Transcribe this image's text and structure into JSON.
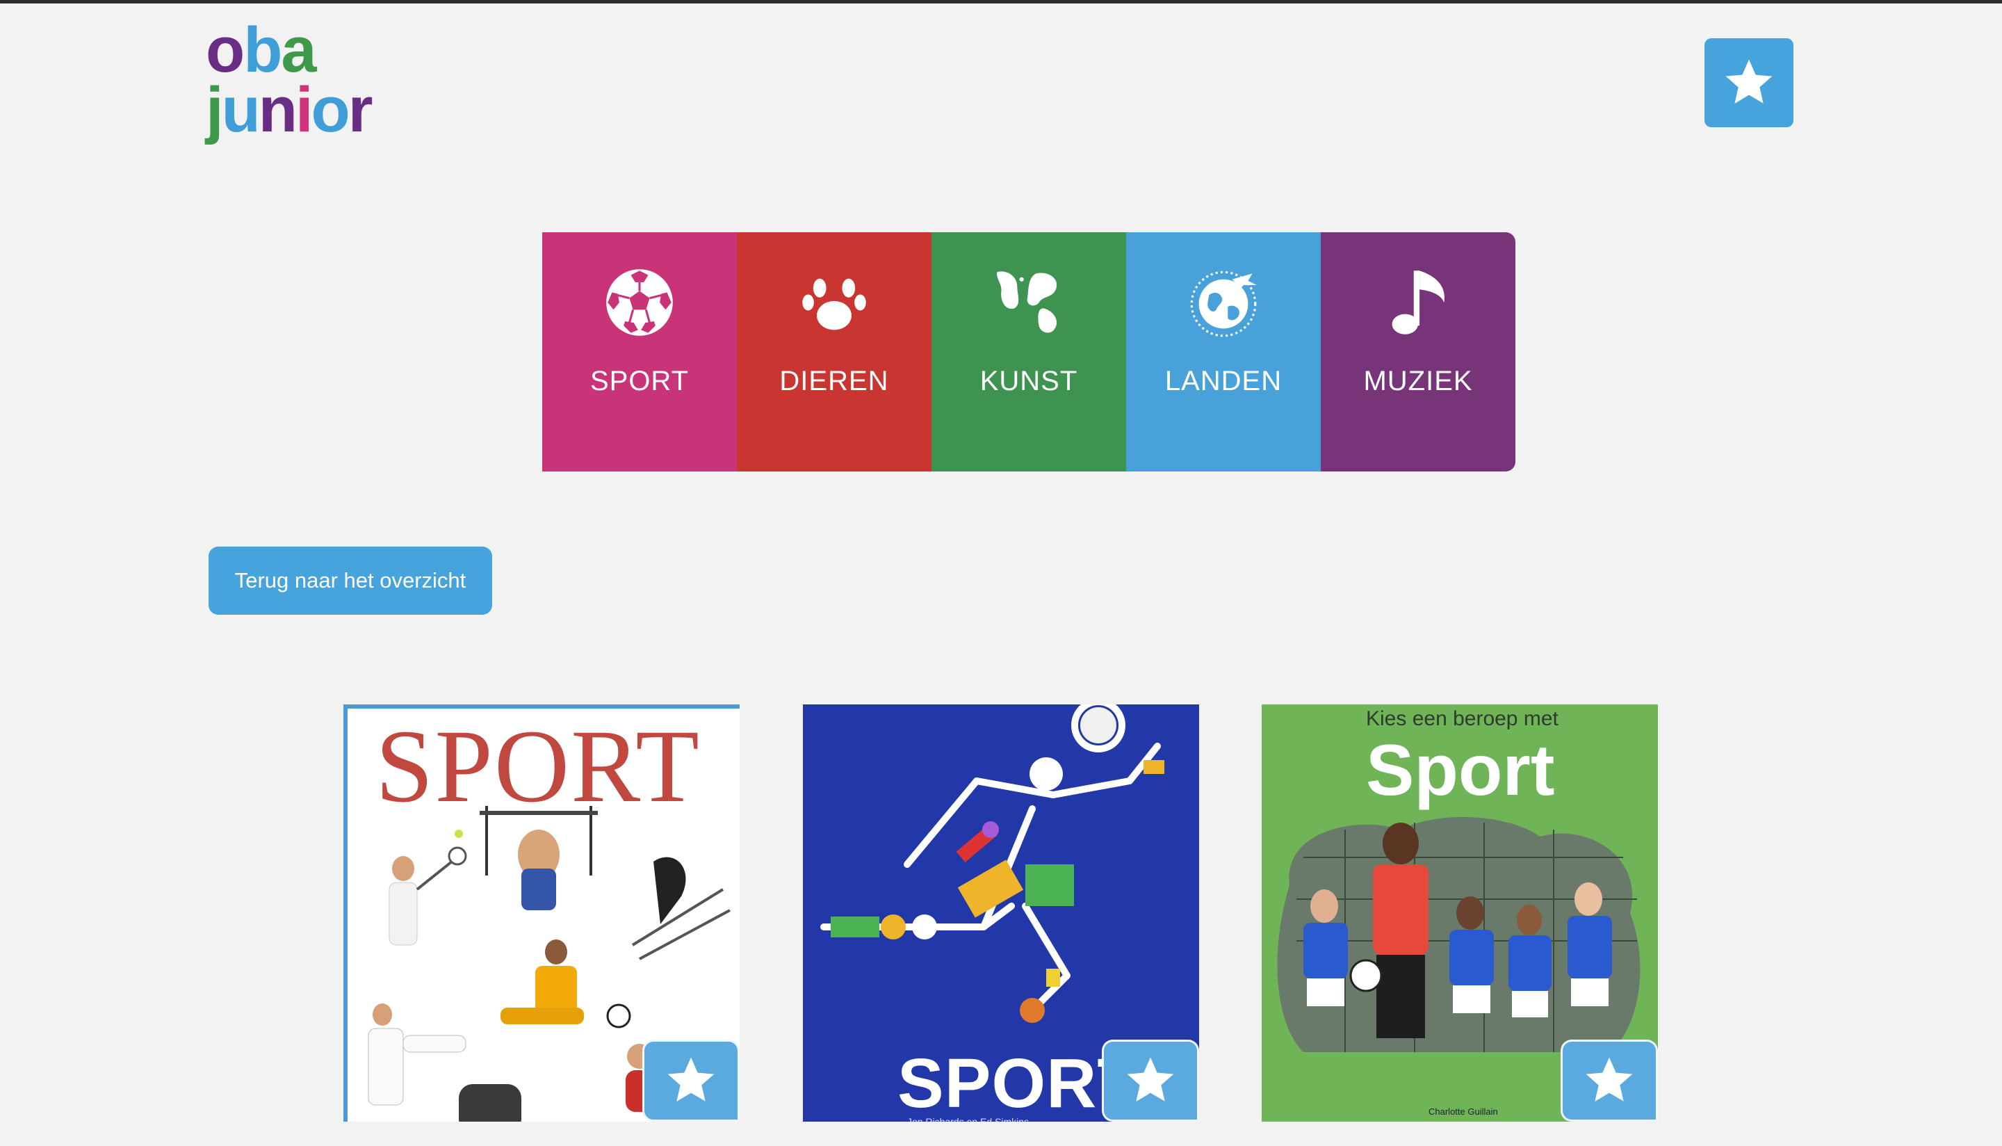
{
  "logo": {
    "row1": [
      {
        "ch": "o",
        "color": "#6a2d84"
      },
      {
        "ch": "b",
        "color": "#3f9ed8"
      },
      {
        "ch": "a",
        "color": "#3e9a49"
      }
    ],
    "row2": [
      {
        "ch": "j",
        "color": "#3e9a49"
      },
      {
        "ch": "u",
        "color": "#3f9ed8"
      },
      {
        "ch": "n",
        "color": "#6a2d84"
      },
      {
        "ch": "i",
        "color": "#d1337a"
      },
      {
        "ch": "o",
        "color": "#3f9ed8"
      },
      {
        "ch": "r",
        "color": "#6a2d84"
      }
    ]
  },
  "header": {
    "favorites_icon": "star-icon"
  },
  "categories": [
    {
      "label": "SPORT",
      "color": "#c93378",
      "icon": "soccer-ball-icon"
    },
    {
      "label": "DIEREN",
      "color": "#c93530",
      "icon": "paw-icon"
    },
    {
      "label": "KUNST",
      "color": "#3f9350",
      "icon": "paint-splash-icon"
    },
    {
      "label": "LANDEN",
      "color": "#48a2d9",
      "icon": "globe-plane-icon"
    },
    {
      "label": "MUZIEK",
      "color": "#773479",
      "icon": "music-note-icon"
    }
  ],
  "back_button": "Terug naar het overzicht",
  "books": [
    {
      "title": "SPORT"
    },
    {
      "title": "SPORT",
      "author": "Jon Richards en Ed Simkins"
    },
    {
      "subtitle": "Kies een beroep met",
      "title": "Sport",
      "author": "Charlotte Guillain"
    }
  ]
}
